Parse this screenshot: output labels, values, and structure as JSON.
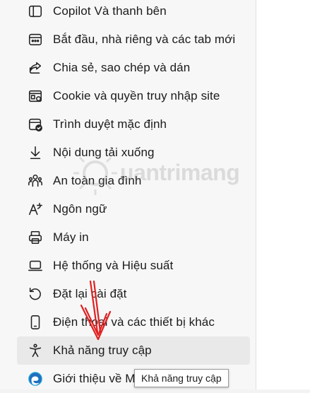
{
  "settings_menu": {
    "items": [
      {
        "label": "Copilot Và thanh bên",
        "icon": "sidebar-icon"
      },
      {
        "label": "Bắt đầu, nhà riêng và các tab mới",
        "icon": "start-page-icon"
      },
      {
        "label": "Chia sẻ, sao chép và dán",
        "icon": "share-icon"
      },
      {
        "label": "Cookie và quyền truy nhập site",
        "icon": "cookie-permissions-icon"
      },
      {
        "label": "Trình duyệt mặc định",
        "icon": "default-browser-icon"
      },
      {
        "label": "Nội dung tải xuống",
        "icon": "download-icon"
      },
      {
        "label": "An toàn gia đình",
        "icon": "family-icon"
      },
      {
        "label": "Ngôn ngữ",
        "icon": "language-icon"
      },
      {
        "label": "Máy in",
        "icon": "printer-icon"
      },
      {
        "label": "Hệ thống và Hiệu suất",
        "icon": "laptop-icon"
      },
      {
        "label": "Đặt lại cài đặt",
        "icon": "reset-icon"
      },
      {
        "label": "Điện thoại và các thiết bị khác",
        "icon": "phone-icon"
      },
      {
        "label": "Khả năng truy cập",
        "icon": "accessibility-icon",
        "hovered": true
      },
      {
        "label": "Giới thiệu về M",
        "icon": "edge-logo-icon"
      }
    ]
  },
  "tooltip": {
    "text": "Khả năng truy cập"
  },
  "watermark": {
    "text": "uantrimang"
  },
  "colors": {
    "annotation_arrow": "#e02020",
    "hover_bg": "#e9e9e9",
    "panel_bg": "#f7f7f7"
  }
}
